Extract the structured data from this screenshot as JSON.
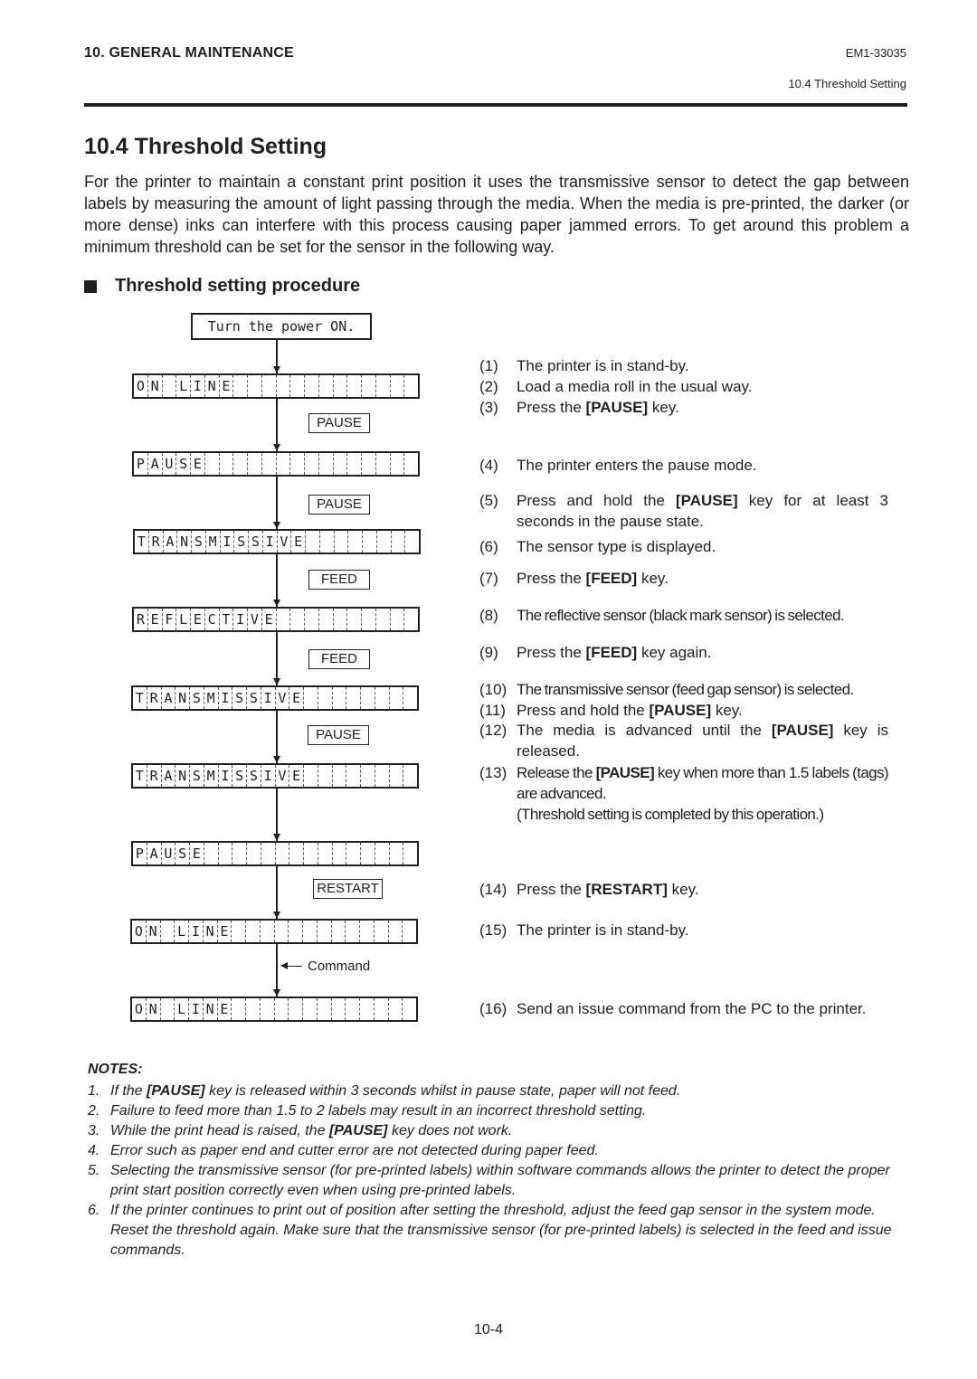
{
  "header": {
    "chapter": "10. GENERAL MAINTENANCE",
    "doc_code": "EM1-33035",
    "section_ref": "10.4 Threshold Setting"
  },
  "title": "10.4  Threshold Setting",
  "intro": "For the printer to maintain a constant print position it uses the transmissive sensor to detect the gap between labels by measuring the amount of light passing through the media.  When the media is pre-printed, the darker (or more dense) inks can interfere with this process causing paper jammed errors. To get around this problem a minimum threshold can be set for the sensor in the following way.",
  "subheading": "Threshold setting procedure",
  "flowchart": {
    "start": "Turn the power ON.",
    "displays": [
      "ON LINE",
      "PAUSE",
      "TRANSMISSIVE",
      "REFLECTIVE",
      "TRANSMISSIVE",
      "TRANSMISSIVE",
      "PAUSE",
      "ON LINE",
      "ON LINE"
    ],
    "keys": [
      "PAUSE",
      "PAUSE",
      "FEED",
      "FEED",
      "PAUSE",
      "RESTART"
    ],
    "command_label": "Command"
  },
  "steps": [
    {
      "num": "(1)",
      "text": "The printer is in stand-by."
    },
    {
      "num": "(2)",
      "text": "Load a media roll in the usual way."
    },
    {
      "num": "(3)",
      "pre": "Press the ",
      "key": "[PAUSE]",
      "post": " key."
    },
    {
      "num": "(4)",
      "text": "The printer enters the pause mode."
    },
    {
      "num": "(5)",
      "pre": "Press and hold the ",
      "key": "[PAUSE]",
      "post": " key for at least 3 seconds in the pause state."
    },
    {
      "num": "(6)",
      "text": "The sensor type is displayed."
    },
    {
      "num": "(7)",
      "pre": "Press the ",
      "key": "[FEED]",
      "post": " key."
    },
    {
      "num": "(8)",
      "text": "The reflective sensor (black mark sensor) is selected."
    },
    {
      "num": "(9)",
      "pre": "Press the ",
      "key": "[FEED]",
      "post": " key again."
    },
    {
      "num": "(10)",
      "text": "The transmissive sensor (feed gap sensor) is selected."
    },
    {
      "num": "(11)",
      "pre": "Press and hold the ",
      "key": "[PAUSE]",
      "post": " key."
    },
    {
      "num": "(12)",
      "pre": "The media is advanced until the ",
      "key": "[PAUSE]",
      "post": " key is released."
    },
    {
      "num": "(13)",
      "pre": "Release the ",
      "key": "[PAUSE]",
      "post": " key when more than 1.5 labels (tags) are advanced.",
      "extra": "(Threshold setting is completed by this operation.)"
    },
    {
      "num": "(14)",
      "pre": "Press the ",
      "key": "[RESTART]",
      "post": " key."
    },
    {
      "num": "(15)",
      "text": "The printer is in stand-by."
    },
    {
      "num": "(16)",
      "text": "Send an issue command from the PC to the printer."
    }
  ],
  "notes": {
    "heading": "NOTES:",
    "items": [
      {
        "n": "1.",
        "pre": "If the ",
        "key": "[PAUSE]",
        "post": " key is released within 3 seconds whilst in pause state, paper will not feed."
      },
      {
        "n": "2.",
        "text": "Failure to feed more than 1.5 to 2 labels may result in an incorrect threshold setting."
      },
      {
        "n": "3.",
        "pre": "While the print head is raised, the ",
        "key": "[PAUSE]",
        "post": " key does not work."
      },
      {
        "n": "4.",
        "text": "Error such as paper end and cutter error are not detected during paper feed."
      },
      {
        "n": "5.",
        "text": "Selecting the transmissive sensor (for pre-printed labels) within software commands allows the printer to detect the proper print start position correctly even when using pre-printed labels."
      },
      {
        "n": "6.",
        "text": "If the printer continues to print out of position after setting the threshold, adjust the feed gap sensor in the system mode.  Reset the threshold again.  Make sure that the transmissive sensor (for pre-printed labels) is selected in the feed and issue commands."
      }
    ]
  },
  "page_number": "10-4"
}
